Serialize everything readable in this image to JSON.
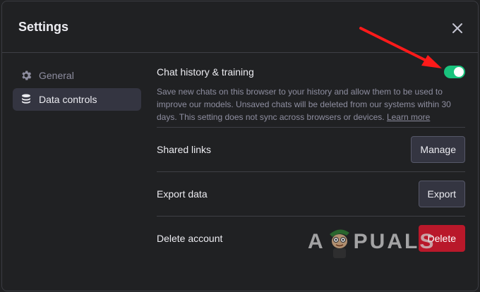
{
  "dialog": {
    "title": "Settings",
    "close_icon": "close-icon"
  },
  "sidebar": {
    "items": [
      {
        "label": "General",
        "icon": "gear-icon",
        "active": false
      },
      {
        "label": "Data controls",
        "icon": "database-icon",
        "active": true
      }
    ]
  },
  "chat_history": {
    "label": "Chat history & training",
    "description": "Save new chats on this browser to your history and allow them to be used to improve our models. Unsaved chats will be deleted from our systems within 30 days. This setting does not sync across browsers or devices.",
    "learn_more": "Learn more",
    "toggle_on": true,
    "toggle_color": "#19c37d"
  },
  "rows": {
    "shared_links": {
      "label": "Shared links",
      "button": "Manage"
    },
    "export_data": {
      "label": "Export data",
      "button": "Export"
    },
    "delete_account": {
      "label": "Delete account",
      "button": "Delete",
      "button_color": "#b9182a"
    }
  },
  "annotation": {
    "arrow_color": "#ff1a1a"
  },
  "watermark": {
    "text_left": "A",
    "text_right": "PUALS"
  }
}
